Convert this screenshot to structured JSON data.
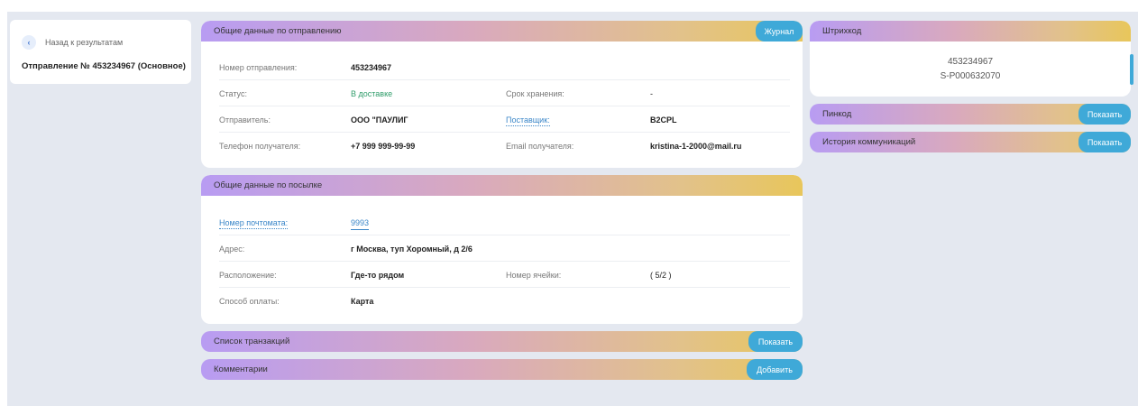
{
  "nav": {
    "back_label": "Назад к результатам",
    "back_icon": "chevron-left-icon",
    "shipment_title": "Отправление № 453234967 (Основное)"
  },
  "shipment": {
    "title": "Общие данные по отправлению",
    "journal_button": "Журнал",
    "number_label": "Номер отправления:",
    "number_value": "453234967",
    "status_label": "Статус:",
    "status_value": "В доставке",
    "storage_label": "Срок хранения:",
    "storage_value": "-",
    "sender_label": "Отправитель:",
    "sender_value": "ООО \"ПАУЛИГ",
    "supplier_label": "Поставщик:",
    "supplier_value": "B2CPL",
    "phone_label": "Телефон получателя:",
    "phone_value": "+7 999 999-99-99",
    "email_label": "Email получателя:",
    "email_value": "kristina-1-2000@mail.ru"
  },
  "parcel": {
    "title": "Общие данные по посылке",
    "postamat_label": "Номер почтомата:",
    "postamat_value": "9993",
    "address_label": "Адрес:",
    "address_value": "г Москва, туп Хоромный, д 2/6",
    "location_label": "Расположение:",
    "location_value": "Где-то рядом",
    "cell_label": "Номер ячейки:",
    "cell_value": "( 5/2 )",
    "payment_label": "Способ оплаты:",
    "payment_value": "Карта"
  },
  "transactions": {
    "title": "Список транзакций",
    "button": "Показать"
  },
  "comments": {
    "title": "Комментарии",
    "button": "Добавить"
  },
  "barcode": {
    "title": "Штрихкод",
    "value1": "453234967",
    "value2": "S-P000632070"
  },
  "pincode": {
    "title": "Пинкод",
    "button": "Показать"
  },
  "history": {
    "title": "История коммуникаций",
    "button": "Показать"
  },
  "colors": {
    "accent_button": "#3fa9d8",
    "status_green": "#2f9c6a",
    "link": "#3a86c8",
    "gradient_start": "#b89cf2",
    "gradient_end": "#e8c65b"
  }
}
